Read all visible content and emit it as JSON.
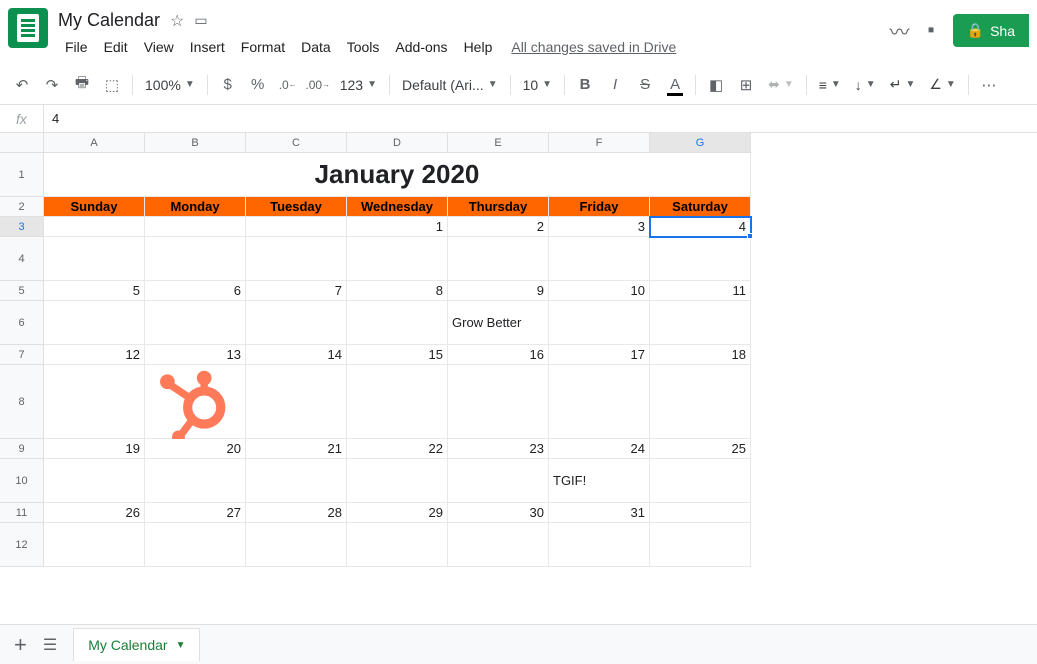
{
  "doc": {
    "title": "My Calendar",
    "save_status": "All changes saved in Drive"
  },
  "menu": {
    "file": "File",
    "edit": "Edit",
    "view": "View",
    "insert": "Insert",
    "format": "Format",
    "data": "Data",
    "tools": "Tools",
    "addons": "Add-ons",
    "help": "Help"
  },
  "share": {
    "label": "Sha"
  },
  "toolbar": {
    "zoom": "100%",
    "font": "Default (Ari...",
    "fontsize": "10",
    "currency": "$",
    "percent": "%",
    "dec_dec": ".0",
    "dec_inc": ".00",
    "more_fmt": "123"
  },
  "formula": {
    "fx": "fx",
    "value": "4"
  },
  "columns": [
    "A",
    "B",
    "C",
    "D",
    "E",
    "F",
    "G"
  ],
  "rows": [
    "1",
    "2",
    "3",
    "4",
    "5",
    "6",
    "7",
    "8",
    "9",
    "10",
    "11",
    "12"
  ],
  "selected": {
    "col": "G",
    "row": "3"
  },
  "calendar": {
    "title": "January 2020",
    "days": [
      "Sunday",
      "Monday",
      "Tuesday",
      "Wednesday",
      "Thursday",
      "Friday",
      "Saturday"
    ],
    "weeks": [
      {
        "nums": [
          "",
          "",
          "",
          "1",
          "2",
          "3",
          "4"
        ],
        "content": [
          "",
          "",
          "",
          "",
          "",
          "",
          ""
        ]
      },
      {
        "nums": [
          "5",
          "6",
          "7",
          "8",
          "9",
          "10",
          "11"
        ],
        "content": [
          "",
          "",
          "",
          "",
          "Grow Better",
          "",
          ""
        ]
      },
      {
        "nums": [
          "12",
          "13",
          "14",
          "15",
          "16",
          "17",
          "18"
        ],
        "content": [
          "",
          "HUBSPOT_ICON",
          "",
          "",
          "",
          "",
          ""
        ]
      },
      {
        "nums": [
          "19",
          "20",
          "21",
          "22",
          "23",
          "24",
          "25"
        ],
        "content": [
          "",
          "",
          "",
          "",
          "",
          "TGIF!",
          ""
        ]
      },
      {
        "nums": [
          "26",
          "27",
          "28",
          "29",
          "30",
          "31",
          ""
        ],
        "content": [
          "",
          "",
          "",
          "",
          "",
          "",
          ""
        ]
      }
    ]
  },
  "sheets": {
    "tab1": "My Calendar"
  }
}
